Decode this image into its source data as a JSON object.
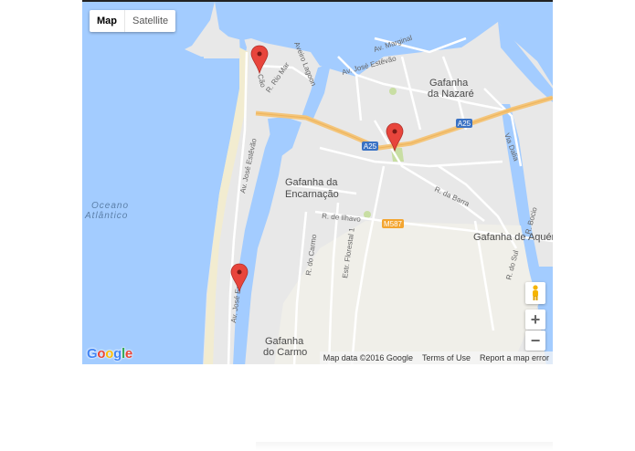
{
  "map": {
    "maptype": {
      "map_label": "Map",
      "satellite_label": "Satellite",
      "selected": "Map"
    },
    "labels": {
      "ocean_line1": "Oceano",
      "ocean_line2": "Atlântico",
      "nazare_line1": "Gafanha",
      "nazare_line2": "da Nazaré",
      "encarnacao_line1": "Gafanha da",
      "encarnacao_line2": "Encarnação",
      "aquem": "Gafanha de Aquém",
      "carmo_line1": "Gafanha",
      "carmo_line2": "do Carmo",
      "av_marginal": "Av. Marginal",
      "av_jose_estevao_top": "Av. José Estêvão",
      "av_jose_estevao_beach": "Av. José Estêvão",
      "av_jose_estevao_south": "Av. José Est",
      "r_de_ilhavo": "R. de Ilhavo",
      "r_da_barra": "R. da Barra",
      "r_do_carmo": "R. do Carmo",
      "estr_florestal": "Estr. Florestal 1",
      "r_do_sul": "R. do Sul",
      "r_bocio": "R. Bocio",
      "via_dalia": "Via Dalia",
      "rio_mar": "R. Rio Mar",
      "aveiro_lagoon": "Aveiro Lagoon",
      "cao": "Cão"
    },
    "shields": {
      "a25_east": "A25",
      "a25_west": "A25",
      "m587": "M587"
    },
    "markers_count": 3,
    "colors": {
      "water": "#a3ccff",
      "land": "#e8e8e8",
      "beach": "#f2ecd0",
      "highway": "#f4c57a",
      "marker": "#e8453c",
      "park": "#c8dea3"
    },
    "controls": {
      "zoom_in": "+",
      "zoom_out": "−",
      "pegman": "street-view"
    },
    "footer": {
      "attribution": "Map data ©2016 Google",
      "terms": "Terms of Use",
      "report": "Report a map error"
    },
    "logo": "Google"
  }
}
